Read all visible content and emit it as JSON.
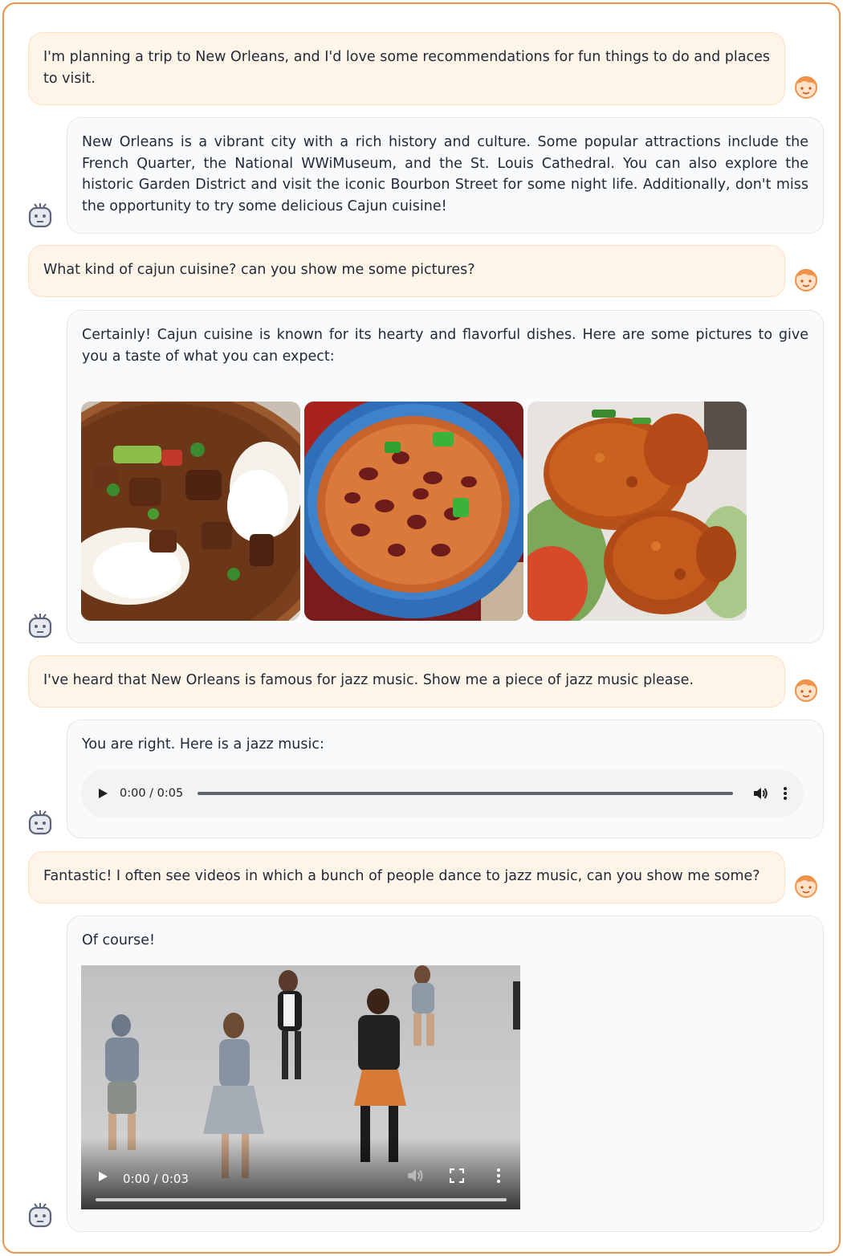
{
  "colors": {
    "user_bubble_bg": "#fff4e8",
    "bot_bubble_bg": "#f9fafb",
    "accent_orange": "#f0934a",
    "bot_avatar": "#5b6478"
  },
  "messages": [
    {
      "role": "user",
      "text": "I'm planning a trip to New Orleans, and I'd love some recommendations for fun things to do and places to visit."
    },
    {
      "role": "bot",
      "text": "New Orleans is a vibrant city with a rich history and culture. Some popular attractions include the French Quarter, the National WWiMuseum, and the St. Louis Cathedral. You can also explore the historic Garden District and visit the iconic Bourbon Street for some night life. Additionally, don't miss the opportunity to try some delicious Cajun cuisine!"
    },
    {
      "role": "user",
      "text": "What kind of cajun cuisine? can you show me some pictures?"
    },
    {
      "role": "bot",
      "text": "Certainly! Cajun cuisine is known for its hearty and flavorful dishes. Here are some pictures to give you a taste of what you can expect:",
      "images": [
        "gumbo-image",
        "red-beans-rice-image",
        "fried-chicken-image"
      ]
    },
    {
      "role": "user",
      "text": "I've heard that New Orleans is famous for jazz music. Show me a piece of jazz music please."
    },
    {
      "role": "bot",
      "text": "You are right. Here is a jazz music:",
      "audio": {
        "time": "0:00 / 0:05"
      }
    },
    {
      "role": "user",
      "text": "Fantastic! I often see videos in which a bunch of people dance to jazz music, can you show me some?"
    },
    {
      "role": "bot",
      "text": "Of course!",
      "video": {
        "time": "0:00 / 0:03"
      }
    }
  ],
  "icons": {
    "user_avatar": "user-avatar-icon",
    "bot_avatar": "robot-avatar-icon",
    "play": "play-icon",
    "volume": "volume-icon",
    "more": "more-vertical-icon",
    "fullscreen": "fullscreen-icon"
  }
}
